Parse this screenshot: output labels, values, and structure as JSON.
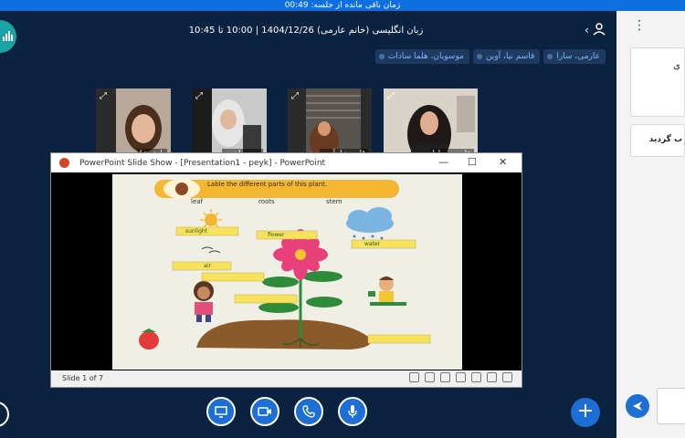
{
  "timer": {
    "label": "زمان باقی مانده از جلسه: 00:49"
  },
  "meeting": {
    "title": "زبان انگلیسی (خانم عارمی) 1404/12/26 | 10:00 تا 10:45"
  },
  "speaker_pills": [
    {
      "name": "عارمی، سارا"
    },
    {
      "name": "قاسم نیا، آوین"
    },
    {
      "name": "موسویان، هلما سادات"
    }
  ],
  "participants": [
    {
      "name": "یاری، تیا"
    },
    {
      "name": "موسویان، ه"
    },
    {
      "name": "قاسم نیا، آوین"
    },
    {
      "name": "عارمی، سارا"
    }
  ],
  "ppt_window": {
    "title": "PowerPoint Slide Show - [Presentation1 - peyk] - PowerPoint",
    "minimize": "—",
    "restore": "☐",
    "close": "✕",
    "slide_number": "Slide 1 of 7"
  },
  "slide": {
    "heading": "Lable the different parts of this plant.",
    "word_bank": [
      "leaf",
      "roots",
      "stem"
    ],
    "labels": {
      "sunlight": "sunlight",
      "flower": "flower",
      "water": "water",
      "air": "air"
    }
  },
  "side_panel": {
    "card1_text": "ی",
    "card2_text": "ب گردید"
  },
  "colors": {
    "accent": "#1d6fd6",
    "background": "#0b2340",
    "pill_bg": "#1e3a5f",
    "pill_text": "#7fb2ff",
    "label_yellow": "#f7e25d"
  },
  "controls": {
    "icons": [
      "screen-share-icon",
      "camera-icon",
      "phone-icon",
      "microphone-icon",
      "plus-icon"
    ]
  }
}
